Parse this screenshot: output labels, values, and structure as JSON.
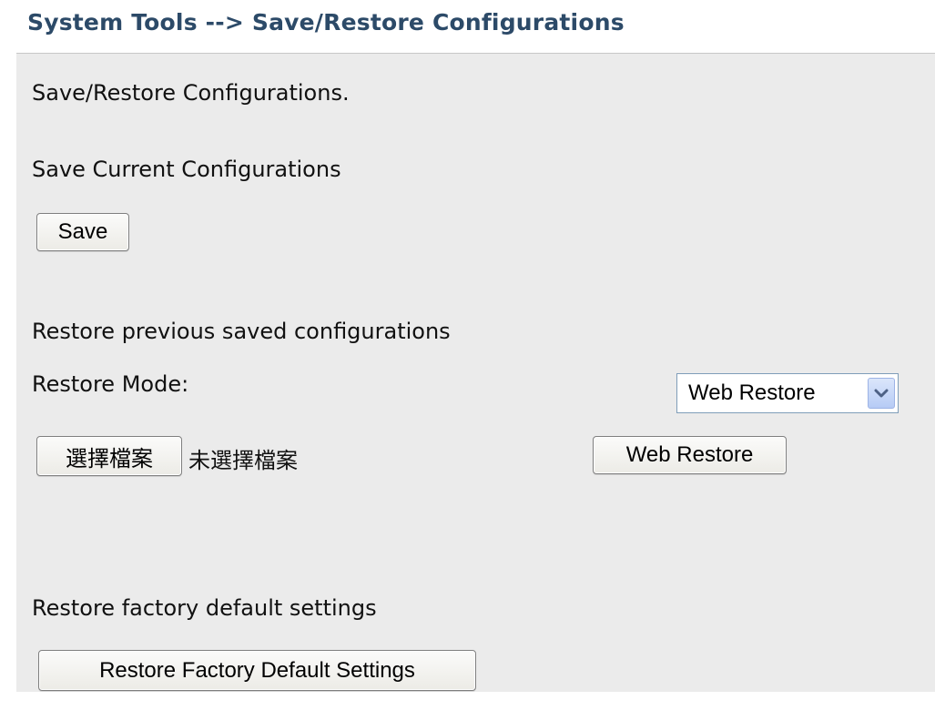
{
  "header": {
    "title": "System Tools --> Save/Restore Configurations"
  },
  "intro": {
    "text": "Save/Restore Configurations."
  },
  "save_section": {
    "heading": "Save Current Configurations",
    "save_label": "Save"
  },
  "restore_section": {
    "heading": "Restore previous saved configurations",
    "mode_label": "Restore Mode:",
    "mode_value": "Web Restore",
    "file_button_label": "選擇檔案",
    "file_status": "未選擇檔案",
    "restore_button_label": "Web Restore"
  },
  "factory_section": {
    "heading": "Restore factory default settings",
    "button_label": "Restore Factory Default Settings"
  },
  "colors": {
    "title": "#2c4a68",
    "panel_background": "#ebebeb",
    "dropdown_arrow": "#4d6185"
  },
  "icons": {
    "dropdown": "chevron-down-icon"
  }
}
